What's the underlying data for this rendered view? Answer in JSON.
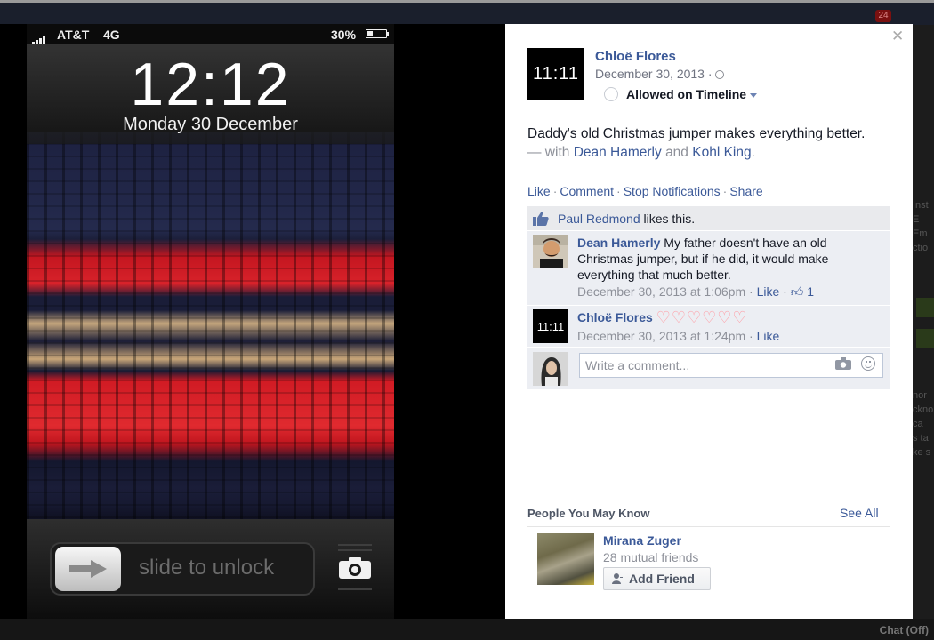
{
  "lock_screen": {
    "carrier": "AT&T",
    "network": "4G",
    "battery_percent": "30%",
    "battery_level": 0.3,
    "time": "12:12",
    "date": "Monday 30 December",
    "slide_text": "slide to unlock"
  },
  "post": {
    "author": "Chloë Flores",
    "author_avatar_text": "11:11",
    "date": "December 30, 2013 ·",
    "privacy_icon": "globe-icon",
    "timeline_label": "Allowed on Timeline",
    "text": "Daddy's old Christmas jumper makes everything better.",
    "tag_prefix": "— with",
    "tagged": [
      "Dean Hamerly",
      "Kohl King"
    ],
    "tag_and": "and",
    "tag_suffix": ".",
    "actions": [
      "Like",
      "Comment",
      "Stop Notifications",
      "Share"
    ],
    "likes": {
      "name": "Paul Redmond",
      "text": " likes this."
    }
  },
  "comments": [
    {
      "name": "Dean Hamerly",
      "text": " My father doesn't have an old Christmas jumper, but if he did, it would make everything that much better.",
      "timestamp": "December 30, 2013 at 1:06pm · ",
      "like": "Like",
      "like_count": "1"
    },
    {
      "name": "Chloë Flores",
      "avatar_text": "11:11",
      "hearts": "♡♡♡♡♡♡",
      "timestamp": "December 30, 2013 at 1:24pm · ",
      "like": "Like"
    }
  ],
  "comment_input": {
    "placeholder": "Write a comment..."
  },
  "people_you_may_know": {
    "title": "People You May Know",
    "see_all": "See All",
    "person": {
      "name": "Mirana Zuger",
      "mutual": "28 mutual friends",
      "button": "Add Friend"
    }
  },
  "background": {
    "notification_count": "24",
    "chat_label": "Chat (Off)",
    "side_text": [
      "Inst",
      "E",
      "Em",
      "ctio",
      "nor",
      "ckno",
      "ca",
      "s ta",
      "ke s"
    ]
  },
  "colors": {
    "facebook_blue": "#3b5998",
    "meta_gray": "#8d9099",
    "comment_bg": "#eceef3"
  }
}
